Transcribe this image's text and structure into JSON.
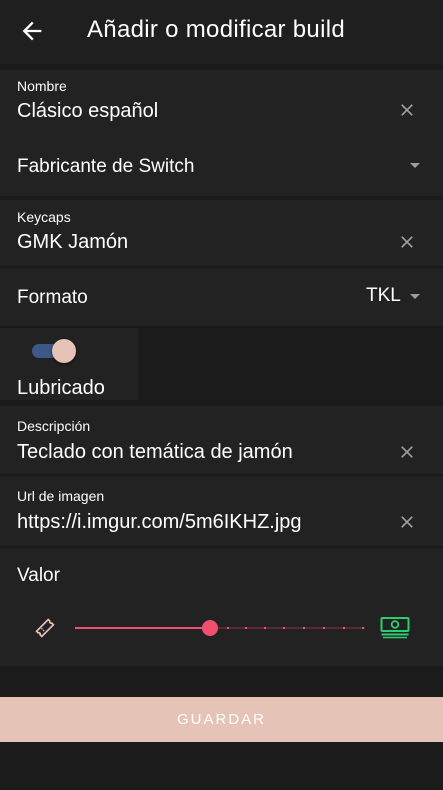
{
  "header": {
    "title": "Añadir o modificar build",
    "back_icon": "arrow-left-icon"
  },
  "fields": {
    "nombre": {
      "label": "Nombre",
      "value": "Clásico español"
    },
    "fabricante": {
      "label": "Fabricante de Switch",
      "value": ""
    },
    "keycaps": {
      "label": "Keycaps",
      "value": "GMK Jamón"
    },
    "formato": {
      "label": "Formato",
      "value": "TKL"
    },
    "lubricado": {
      "label": "Lubricado",
      "checked": true
    },
    "descripcion": {
      "label": "Descripción",
      "value": "Teclado con temática de jamón"
    },
    "url": {
      "label": "Url de imagen",
      "value": "https://i.imgur.com/5m6IKHZ.jpg"
    },
    "valor": {
      "label": "Valor",
      "level_fraction": 0.47,
      "min_icon": "ticket-icon",
      "max_icon": "money-icon"
    }
  },
  "actions": {
    "save_label": "GUARDAR"
  },
  "colors": {
    "background": "#1b1b1b",
    "panel": "#222222",
    "accent": "#f0506e",
    "switch_track": "#3c5a86",
    "button": "#e6c3b7",
    "money_icon": "#2ecc71"
  }
}
